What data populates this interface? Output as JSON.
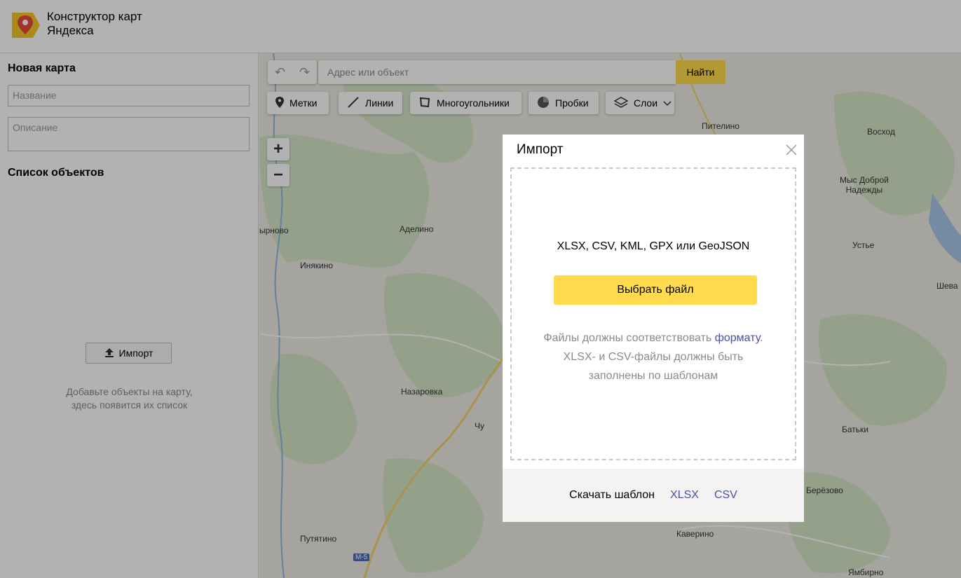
{
  "header": {
    "brand_line1": "Конструктор карт",
    "brand_line2": "Яндекса"
  },
  "sidebar": {
    "title": "Новая карта",
    "name_placeholder": "Название",
    "description_placeholder": "Описание",
    "list_title": "Список объектов",
    "import_button": "Импорт",
    "hint_line1": "Добавьте объекты на карту,",
    "hint_line2": "здесь появится их список"
  },
  "map": {
    "search_placeholder": "Адрес или объект",
    "search_button": "Найти",
    "tools": {
      "placemarks": "Метки",
      "lines": "Линии",
      "polygons": "Многоугольники",
      "traffic": "Пробки",
      "layers": "Слои"
    },
    "zoom_in": "+",
    "zoom_out": "−",
    "places": {
      "pitelino": "Пителино",
      "voskhod": "Восход",
      "mys_line1": "Мыс Доброй",
      "mys_line2": "Надежды",
      "yrnovo": "ырново",
      "adelino": "Аделино",
      "inyakino": "Инякино",
      "ustye": "Устье",
      "sheva": "Шева",
      "nazarovka": "Назаровка",
      "batki": "Батьки",
      "berezovo": "Берёзово",
      "putyatino": "Путятино",
      "kaverino": "Каверино",
      "yambirno": "Ямбирно",
      "road_m5": "М-5",
      "chu": "Чу"
    }
  },
  "modal": {
    "title": "Импорт",
    "formats": "XLSX, CSV, KML, GPX или GeoJSON",
    "choose_button": "Выбрать файл",
    "note_part1": "Файлы должны соответствовать ",
    "note_link": "формату",
    "note_part2": ".",
    "note_line2": "XLSX- и CSV-файлы должны быть",
    "note_line3": "заполнены по шаблонам",
    "footer_label": "Скачать шаблон",
    "footer_xlsx": "XLSX",
    "footer_csv": "CSV"
  },
  "colors": {
    "accent_yellow": "#ffdb4d",
    "link": "#4a4fa8",
    "logo_red": "#e84a3c"
  }
}
